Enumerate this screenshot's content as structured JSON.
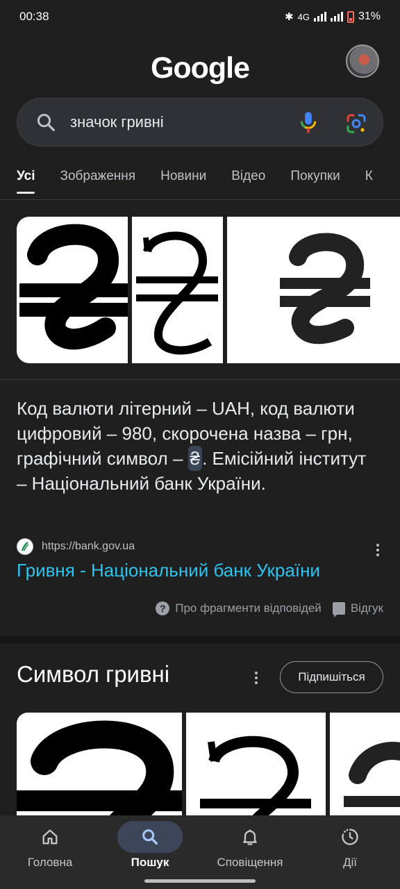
{
  "status_bar": {
    "time": "00:38",
    "network": "4G",
    "battery": "31%"
  },
  "header": {
    "logo": "Google"
  },
  "search": {
    "query": "значок гривні"
  },
  "tabs": [
    {
      "label": "Усі",
      "active": true
    },
    {
      "label": "Зображення"
    },
    {
      "label": "Новини"
    },
    {
      "label": "Відео"
    },
    {
      "label": "Покупки"
    },
    {
      "label": "К"
    }
  ],
  "snippet": {
    "text_before": "Код валюти літерний – UAH, код валюти цифровий – 980, скорочена назва – грн, графічний символ – ",
    "symbol": "₴",
    "text_after": ". Емісійний інститут – Національний банк України."
  },
  "source": {
    "url": "https://bank.gov.ua",
    "title": "Гривня - Національний банк України"
  },
  "feedback": {
    "about": "Про фрагменти відповідей",
    "feedback": "Відгук"
  },
  "section": {
    "title": "Символ гривні",
    "subscribe": "Підпишіться"
  },
  "bottom_nav": [
    {
      "label": "Головна",
      "icon": "home-icon"
    },
    {
      "label": "Пошук",
      "icon": "search-icon",
      "active": true
    },
    {
      "label": "Сповіщення",
      "icon": "bell-icon"
    },
    {
      "label": "Дії",
      "icon": "activity-icon"
    }
  ],
  "colors": {
    "link": "#2ec3f0",
    "background": "#1f1f1f",
    "active_nav": "#3d4658"
  }
}
